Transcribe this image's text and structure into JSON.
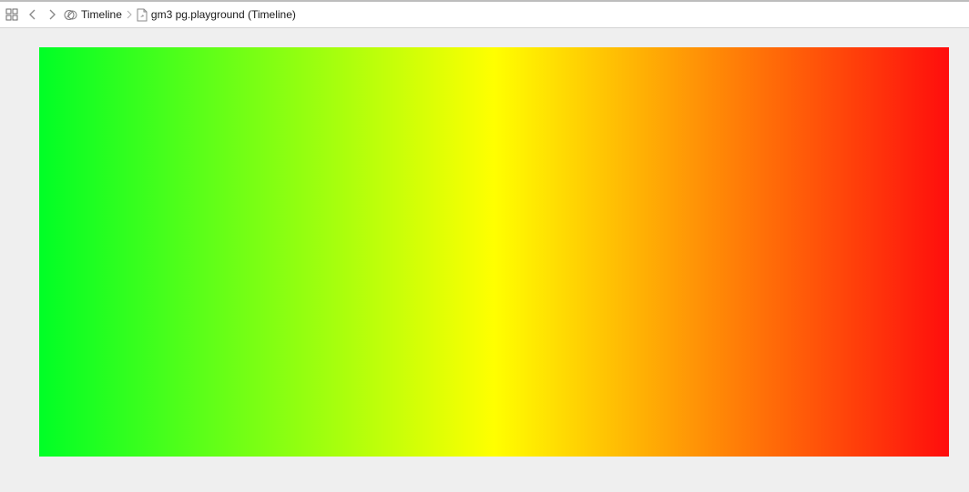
{
  "toolbar": {
    "breadcrumb": [
      {
        "label": "Timeline",
        "icon": "timeline-assistant-icon"
      },
      {
        "label": "gm3 pg.playground (Timeline)",
        "icon": "playground-file-icon"
      }
    ]
  },
  "gradient": {
    "colors": [
      "#00ff26",
      "#ffff00",
      "#ff0d0d"
    ],
    "direction": "left-to-right"
  }
}
